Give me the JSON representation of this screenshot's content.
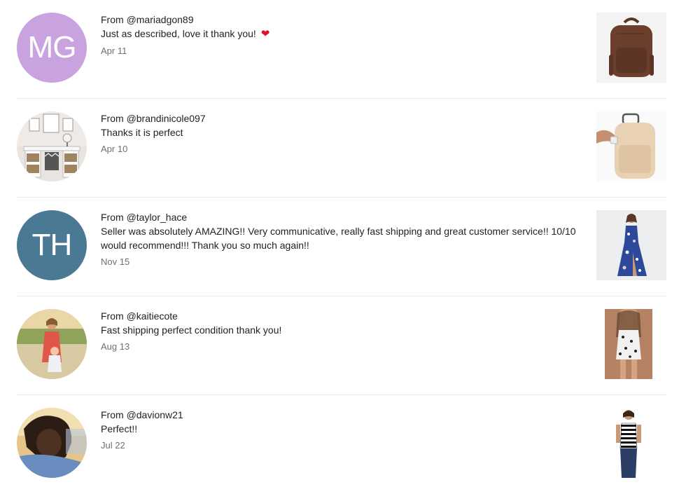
{
  "reviews": [
    {
      "from_prefix": "From ",
      "handle": "@mariadgon89",
      "message": "Just as described, love it thank you!",
      "emoji": "❤",
      "date": "Apr 11",
      "avatar": {
        "type": "initials",
        "initials": "MG",
        "color": "#c9a2e0"
      },
      "product": "brown-backpack"
    },
    {
      "from_prefix": "From ",
      "handle": "@brandinicole097",
      "message": "Thanks it is perfect",
      "date": "Apr 10",
      "avatar": {
        "type": "photo",
        "subject": "home-office-desk"
      },
      "product": "beige-backpack"
    },
    {
      "from_prefix": "From ",
      "handle": "@taylor_hace",
      "message": "Seller was absolutely AMAZING!! Very communicative, really fast shipping and great customer service!! 10/10 would recommend!!! Thank you so much again!!",
      "date": "Nov 15",
      "avatar": {
        "type": "initials",
        "initials": "TH",
        "color": "#4a7a93"
      },
      "product": "blue-floral-maxi-dress"
    },
    {
      "from_prefix": "From ",
      "handle": "@kaitiecote",
      "message": "Fast shipping perfect condition thank you!",
      "date": "Aug 13",
      "avatar": {
        "type": "photo",
        "subject": "woman-and-child-field"
      },
      "product": "black-white-print-romper"
    },
    {
      "from_prefix": "From ",
      "handle": "@davionw21",
      "message": "Perfect!!",
      "date": "Jul 22",
      "avatar": {
        "type": "photo",
        "subject": "selfie"
      },
      "product": "striped-halter-top"
    }
  ],
  "colors": {
    "text": "#222222",
    "date": "#707070",
    "divider": "#e6e6e6",
    "heart": "#e0112b"
  }
}
